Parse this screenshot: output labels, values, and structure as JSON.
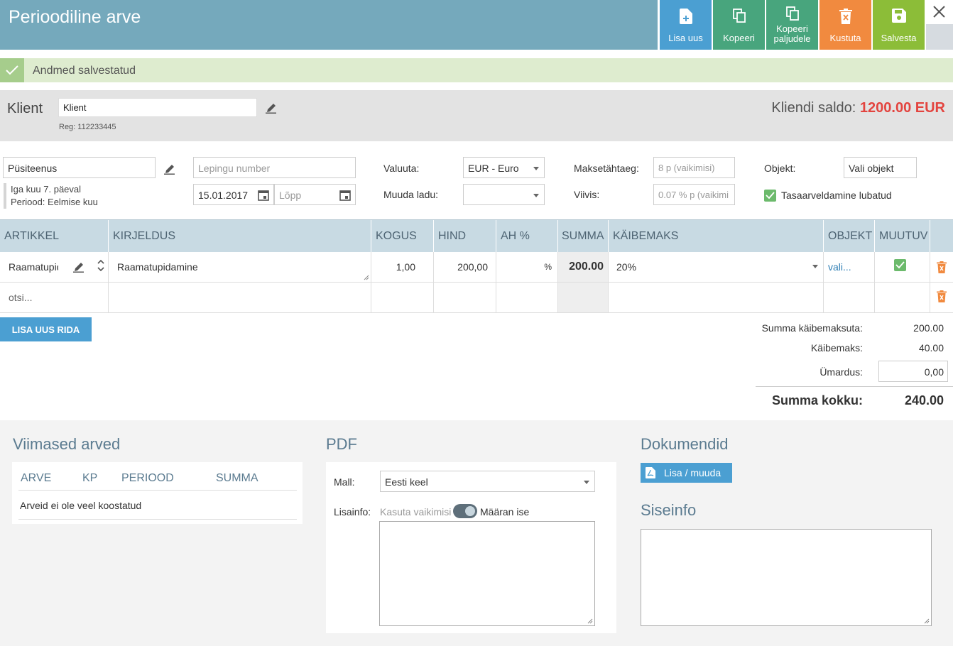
{
  "header": {
    "title": "Perioodiline arve",
    "buttons": {
      "add_new": "Lisa uus",
      "copy": "Kopeeri",
      "copy_many_line1": "Kopeeri",
      "copy_many_line2": "paljudele",
      "delete": "Kustuta",
      "save": "Salvesta"
    }
  },
  "notification": {
    "message": "Andmed salvestatud"
  },
  "client": {
    "label": "Klient",
    "value": "Klient",
    "reg": "Reg: 112233445",
    "balance_label": "Kliendi saldo:",
    "balance_value": "1200.00 EUR"
  },
  "form": {
    "service": "Püsiteenus",
    "schedule_line1": "Iga kuu 7. päeval",
    "schedule_line2": "Periood: Eelmise kuu",
    "contract_placeholder": "Lepingu number",
    "start_date": "15.01.2017",
    "end_placeholder": "Lõpp",
    "currency_label": "Valuuta:",
    "currency_value": "EUR - Euro",
    "warehouse_label": "Muuda ladu:",
    "warehouse_value": "",
    "due_label": "Maksetähtaeg:",
    "due_placeholder": "8 p (vaikimisi)",
    "penalty_label": "Viivis:",
    "penalty_placeholder": "0.07 % p (vaikimi",
    "object_label": "Objekt:",
    "object_value": "Vali objekt",
    "offset_label": "Tasaarveldamine lubatud"
  },
  "table": {
    "columns": [
      "ARTIKKEL",
      "KIRJELDUS",
      "KOGUS",
      "HIND",
      "AH %",
      "SUMMA",
      "KÄIBEMAKS",
      "OBJEKT",
      "MUUTUV"
    ],
    "rows": [
      {
        "article": "Raamatupid",
        "description": "Raamatupidamine",
        "quantity": "1,00",
        "price": "200,00",
        "discount_unit": "%",
        "sum": "200.00",
        "vat": "20%",
        "object": "vali..."
      }
    ],
    "search_placeholder": "otsi..."
  },
  "add_row_label": "LISA UUS RIDA",
  "totals": {
    "net_label": "Summa käibemaksuta:",
    "net_value": "200.00",
    "vat_label": "Käibemaks:",
    "vat_value": "40.00",
    "rounding_label": "Ümardus:",
    "rounding_value": "0,00",
    "total_label": "Summa kokku:",
    "total_value": "240.00"
  },
  "recent": {
    "title": "Viimased arved",
    "columns": [
      "ARVE",
      "KP",
      "PERIOOD",
      "SUMMA"
    ],
    "empty": "Arveid ei ole veel koostatud"
  },
  "pdf": {
    "title": "PDF",
    "template_label": "Mall:",
    "template_value": "Eesti keel",
    "extra_label": "Lisainfo:",
    "use_default": "Kasuta vaikimisi",
    "custom": "Määran ise"
  },
  "documents": {
    "title": "Dokumendid",
    "add_button": "Lisa / muuda"
  },
  "internal": {
    "title": "Siseinfo"
  },
  "colors": {
    "header": "#75a9bc",
    "blue": "#4b9fd2",
    "green": "#48a57d",
    "orange": "#f18a3f",
    "lime": "#8cbd38",
    "balance": "#e3443f"
  }
}
